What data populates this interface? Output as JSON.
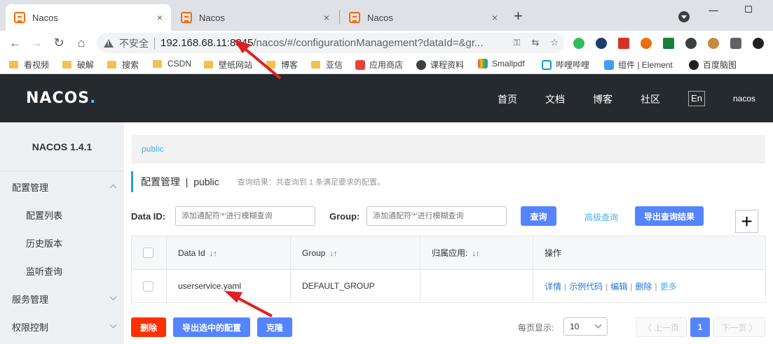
{
  "browser": {
    "tabs": [
      {
        "title": "Nacos"
      },
      {
        "title": "Nacos"
      },
      {
        "title": "Nacos"
      }
    ],
    "new_tab": "+",
    "close_glyph": "×",
    "window": {
      "minimize": "—",
      "maximize": "☐"
    },
    "omnibox": {
      "security_label": "不安全",
      "url_host": "192.168.68.11:8845",
      "url_rest": "/nacos/#/configurationManagement?dataId=&gr..."
    },
    "bookmarks": [
      "看视频",
      "破解",
      "搜索",
      "CSDN",
      "壁纸网站",
      "博客",
      "亚信",
      "应用商店",
      "课程资料",
      "Smallpdf",
      "哔哩哔哩",
      "组件 | Element",
      "百度脑图"
    ]
  },
  "header": {
    "logo_text": "NACOS",
    "logo_dot": ".",
    "nav": [
      "首页",
      "文档",
      "博客",
      "社区"
    ],
    "lang": "En",
    "user": "nacos"
  },
  "sidebar": {
    "version": "NACOS 1.4.1",
    "items": [
      {
        "label": "配置管理"
      },
      {
        "label": "配置列表"
      },
      {
        "label": "历史版本"
      },
      {
        "label": "监听查询"
      },
      {
        "label": "服务管理"
      },
      {
        "label": "权限控制"
      }
    ]
  },
  "main": {
    "breadcrumb": "public",
    "section_title": "配置管理  |  public",
    "result_text": "查询结果：共查询到 1 条满足要求的配置。",
    "filter": {
      "dataid_label": "Data ID:",
      "dataid_placeholder": "添加通配符'*'进行模糊查询",
      "group_label": "Group:",
      "group_placeholder": "添加通配符'*'进行模糊查询",
      "query_button": "查询",
      "advanced_link": "高级查询",
      "export_button": "导出查询结果",
      "add_glyph": "+"
    },
    "table": {
      "columns": [
        "Data Id",
        "Group",
        "归属应用:",
        "操作"
      ],
      "sort_glyph": "↓↑",
      "rows": [
        {
          "data_id": "userservice.yaml",
          "group": "DEFAULT_GROUP",
          "app": "",
          "ops": [
            "详情",
            "示例代码",
            "编辑",
            "删除",
            "更多"
          ]
        }
      ],
      "ops_sep": "|"
    },
    "actions": {
      "delete": "删除",
      "export_selected": "导出选中的配置",
      "clone": "克隆"
    },
    "pagination": {
      "page_size_label": "每页显示:",
      "page_size": "10",
      "prev": "〈 上一页",
      "current": "1",
      "next": "下一页 〉"
    }
  },
  "colors": {
    "header_bg": "#252a2f",
    "primary": "#5584ff",
    "danger": "#ff3000",
    "link": "#4ab1e0",
    "annotation_arrow": "#e02020"
  }
}
